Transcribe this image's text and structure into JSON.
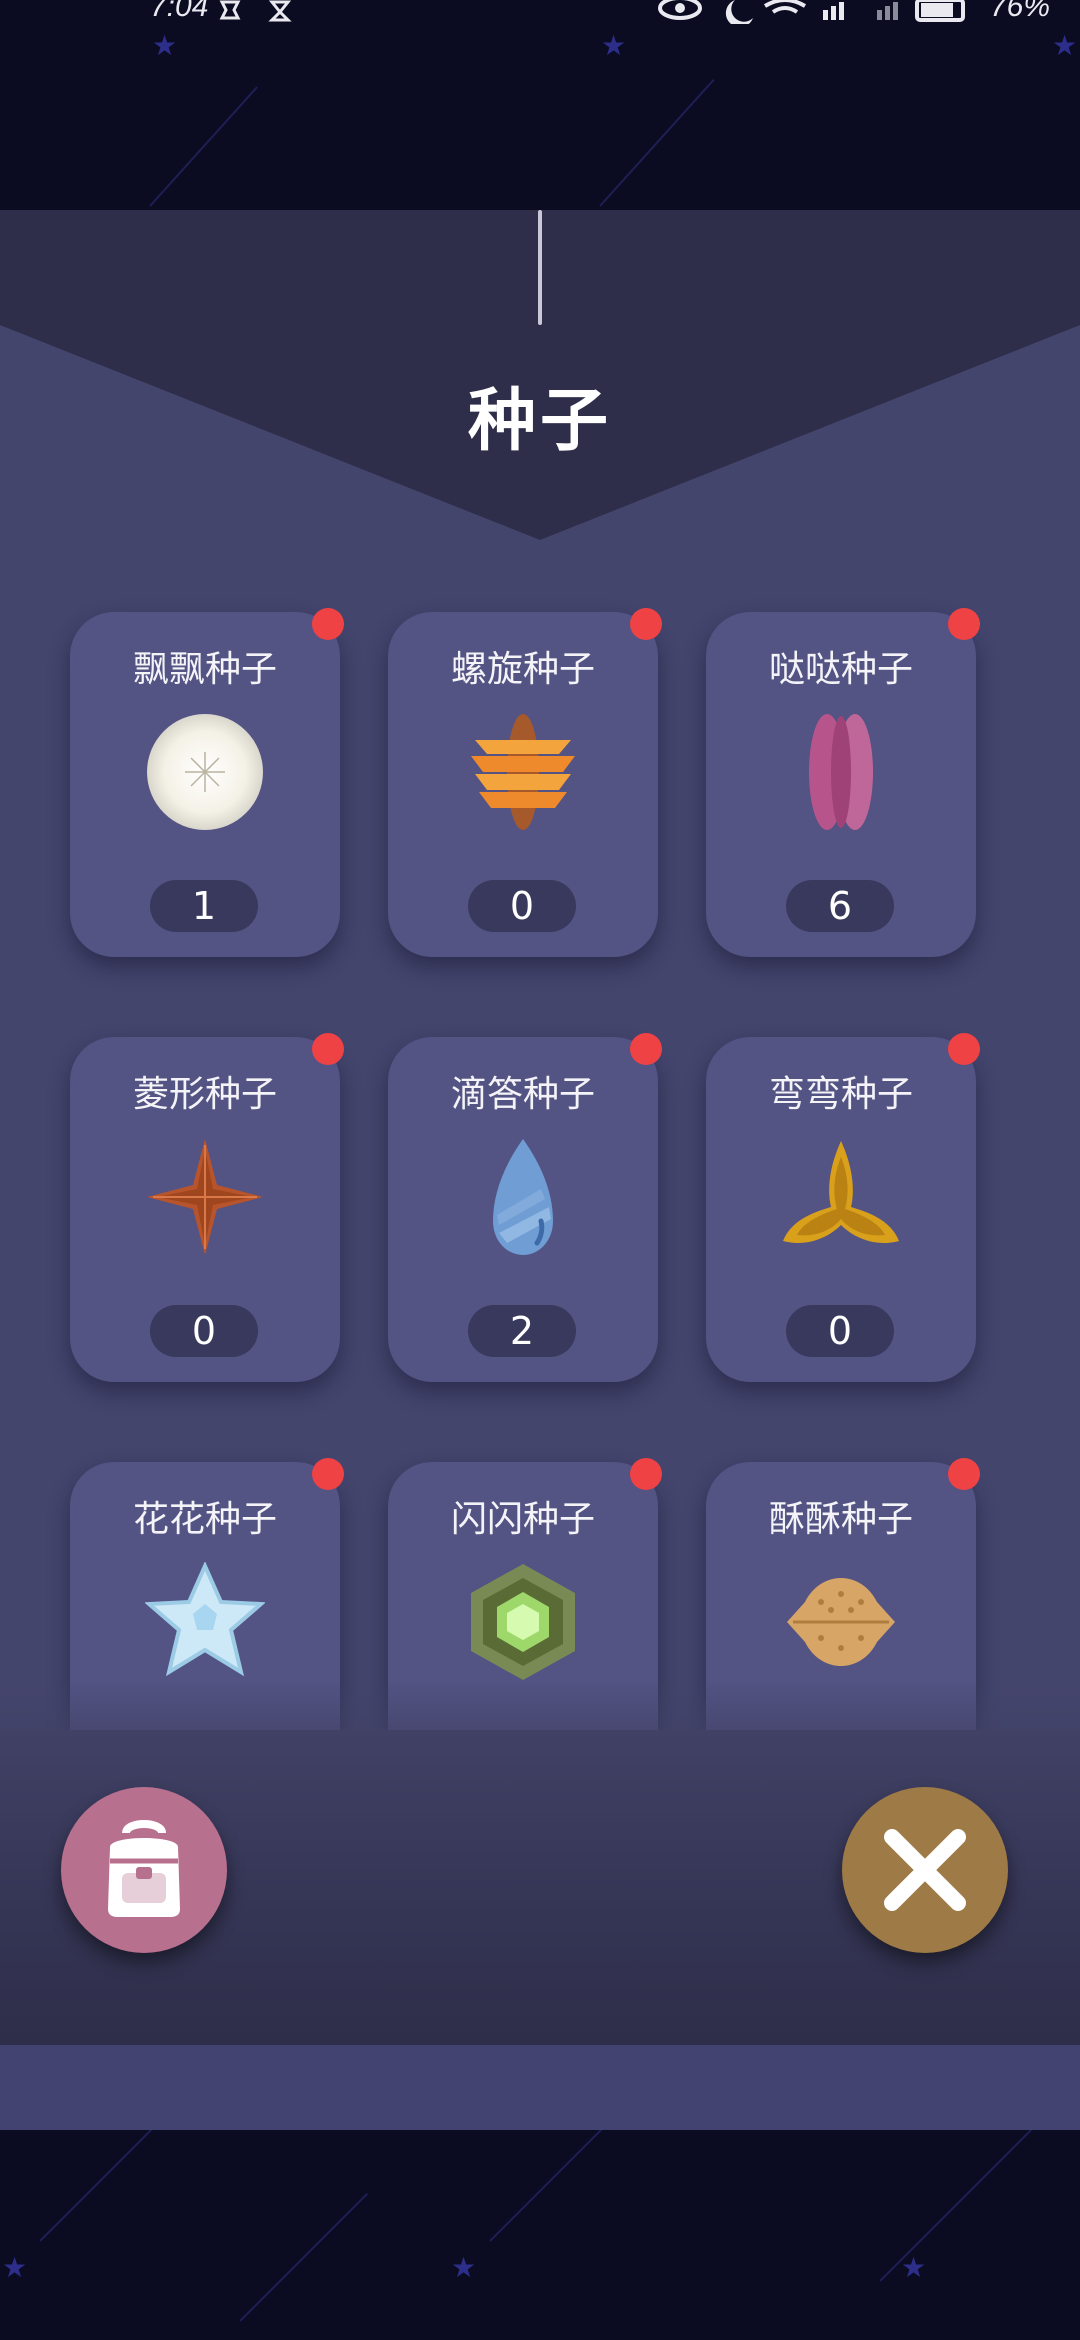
{
  "status_bar": {
    "time": "7:04",
    "battery": "76%"
  },
  "title": "种子",
  "seeds": [
    {
      "name": "飘飘种子",
      "count": "1",
      "icon": "dandelion-seed-icon",
      "badge": true
    },
    {
      "name": "螺旋种子",
      "count": "0",
      "icon": "spiral-seed-icon",
      "badge": true
    },
    {
      "name": "哒哒种子",
      "count": "6",
      "icon": "pod-seed-icon",
      "badge": true
    },
    {
      "name": "菱形种子",
      "count": "0",
      "icon": "diamond-seed-icon",
      "badge": true
    },
    {
      "name": "滴答种子",
      "count": "2",
      "icon": "drop-seed-icon",
      "badge": true
    },
    {
      "name": "弯弯种子",
      "count": "0",
      "icon": "tri-wing-seed-icon",
      "badge": true
    },
    {
      "name": "花花种子",
      "count": "",
      "icon": "flower-seed-icon",
      "badge": true
    },
    {
      "name": "闪闪种子",
      "count": "",
      "icon": "hexagon-seed-icon",
      "badge": true
    },
    {
      "name": "酥酥种子",
      "count": "",
      "icon": "walnut-seed-icon",
      "badge": true
    }
  ],
  "buttons": {
    "backpack_icon": "backpack-icon",
    "close_icon": "close-icon"
  },
  "colors": {
    "panel": "#44456d",
    "card": "#535384",
    "badge": "#ee4245",
    "backpack_button": "#b8708f",
    "close_button": "#9d7a46"
  }
}
